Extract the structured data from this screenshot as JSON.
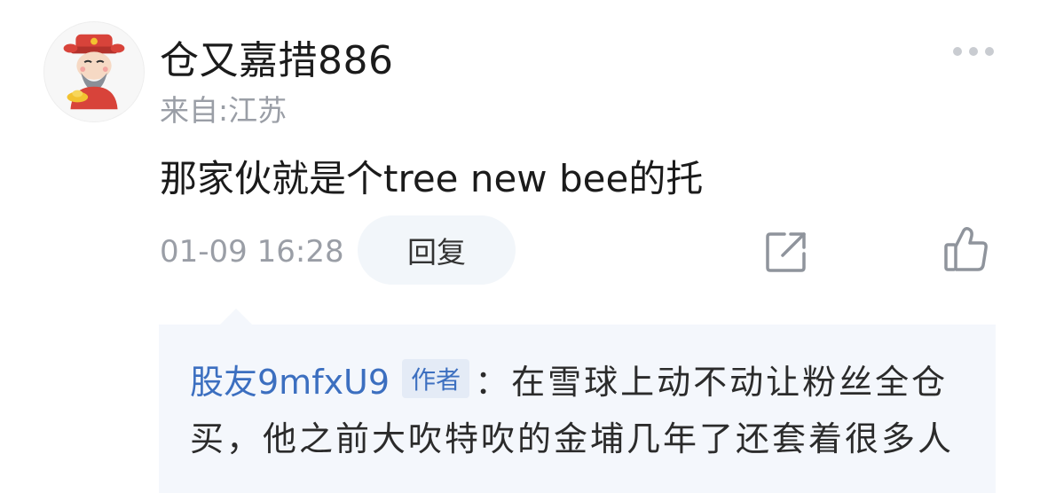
{
  "user": {
    "name": "仓又嘉措886",
    "location": "来自:江苏",
    "avatar_icon": "caishen-avatar-icon"
  },
  "comment": {
    "text": "那家伙就是个tree new bee的托"
  },
  "meta": {
    "timestamp": "01-09 16:28",
    "reply_label": "回复",
    "share_icon": "share-icon",
    "like_icon": "thumbs-up-icon",
    "more_icon": "more-dots-icon"
  },
  "reply": {
    "author": "股友9mfxU9",
    "badge": "作者",
    "line1": "：在雪球上动不动让粉丝全仓",
    "line2": "买，他之前大吹特吹的金埔几年了还套着很多人"
  },
  "colors": {
    "link_blue": "#3c6fc0",
    "muted_gray": "#9a9ea6",
    "reply_bg": "#f4f7fc",
    "button_bg": "#f2f6fa"
  }
}
